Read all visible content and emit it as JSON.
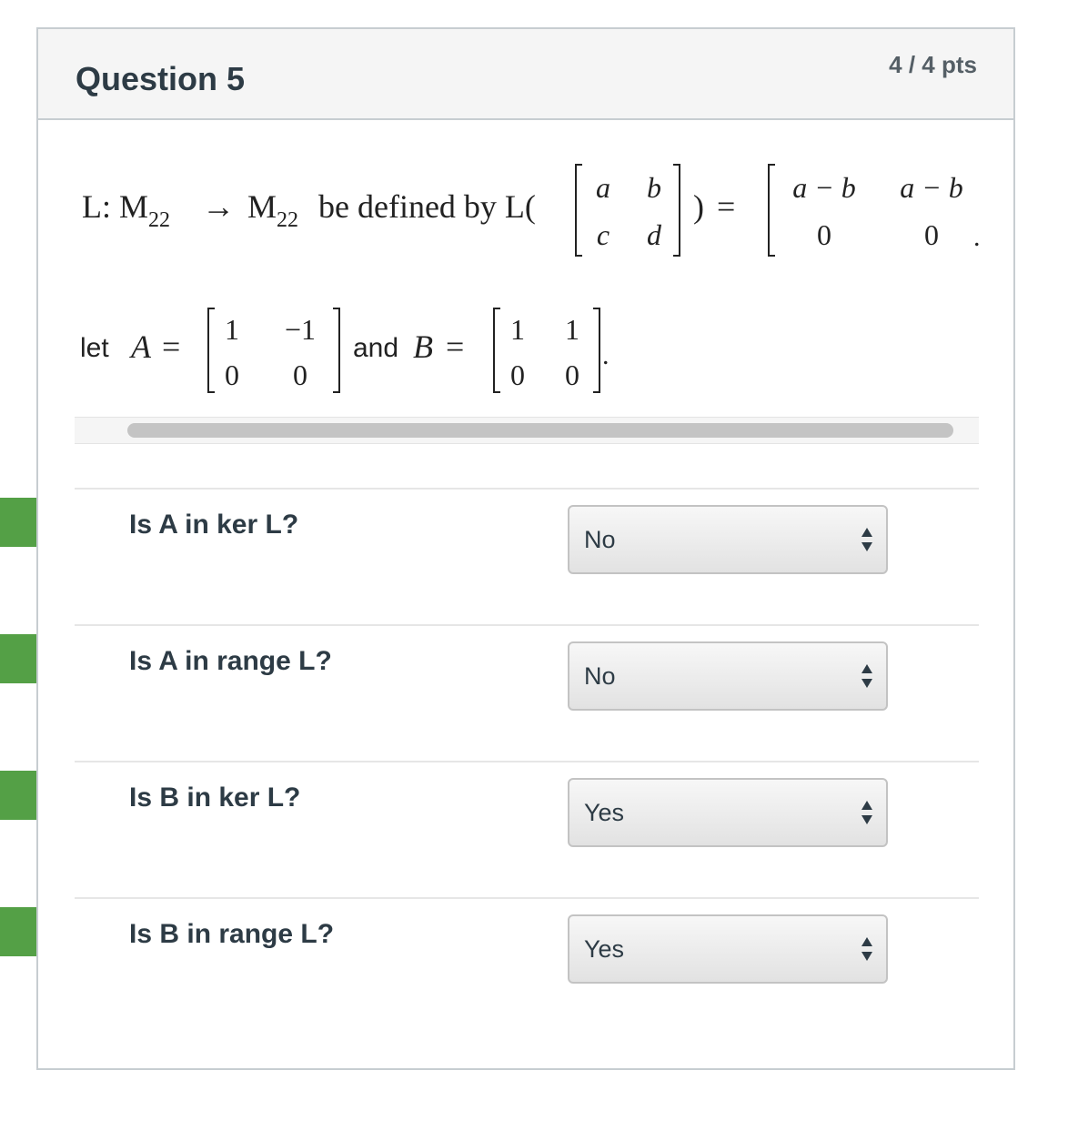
{
  "question": {
    "title": "Question 5",
    "points": "4 / 4 pts"
  },
  "definition": {
    "map_prefix": "L: M",
    "sub1": "22",
    "arrow": "→",
    "codomain": "M",
    "sub2": "22",
    "defined_by": "be defined by L(",
    "close_paren": ")",
    "equals": "=",
    "input_matrix": [
      "a",
      "b",
      "c",
      "d"
    ],
    "output_matrix": [
      "a − b",
      "a − b",
      "0",
      "0"
    ],
    "trailing_punct": "."
  },
  "let_line": {
    "let_text": "let",
    "a_symbol": "A",
    "equals": "=",
    "and_text": "and",
    "b_symbol": "B",
    "matrix_a": [
      "1",
      "−1",
      "0",
      "0"
    ],
    "matrix_b": [
      "1",
      "1",
      "0",
      "0"
    ],
    "trailing_punct": "."
  },
  "answers": [
    {
      "prompt": "Is A in ker L?",
      "selected": "No"
    },
    {
      "prompt": "Is A in range L?",
      "selected": "No"
    },
    {
      "prompt": "Is B in ker L?",
      "selected": "Yes"
    },
    {
      "prompt": "Is B in range L?",
      "selected": "Yes"
    }
  ],
  "colors": {
    "correct_marker": "#54a046",
    "header_bg": "#f5f5f5",
    "border": "#c7cdd1"
  },
  "icons": {
    "correct_marker": "correct-answer-arrow-icon",
    "select_arrows": "up-down-arrows-icon"
  }
}
